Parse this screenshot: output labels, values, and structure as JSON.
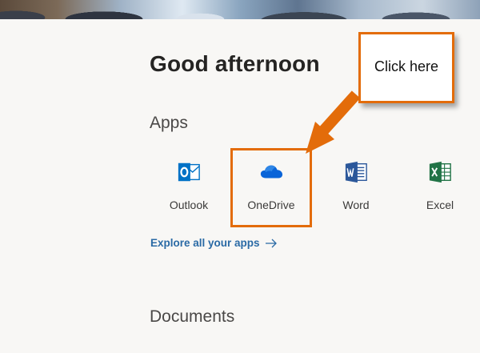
{
  "header": {
    "greeting": "Good afternoon"
  },
  "apps": {
    "title": "Apps",
    "items": [
      {
        "label": "Outlook",
        "icon": "outlook-icon",
        "color": "#0072c6"
      },
      {
        "label": "OneDrive",
        "icon": "onedrive-icon",
        "color": "#0a64d8"
      },
      {
        "label": "Word",
        "icon": "word-icon",
        "color": "#2b579a"
      },
      {
        "label": "Excel",
        "icon": "excel-icon",
        "color": "#217346"
      }
    ],
    "explore_link": "Explore all your apps",
    "explore_icon": "arrow-right-icon"
  },
  "documents": {
    "title": "Documents"
  },
  "annotation": {
    "callout_text": "Click here",
    "highlight_color": "#e36c0a"
  }
}
